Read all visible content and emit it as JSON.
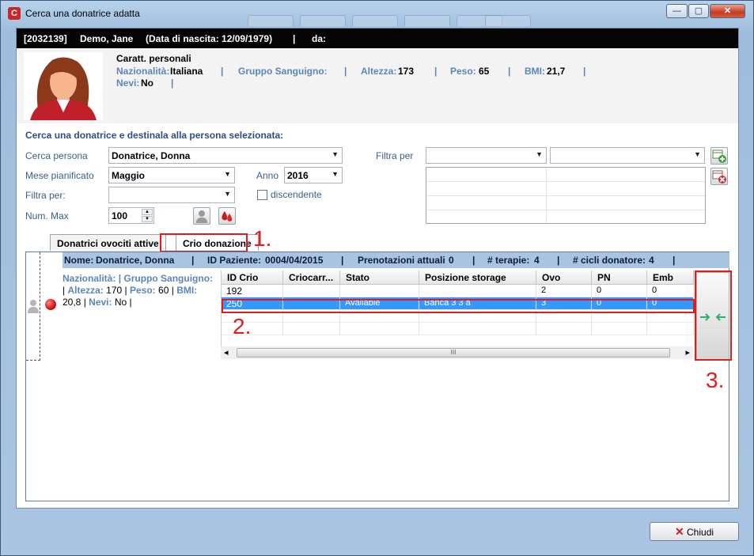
{
  "window": {
    "title": "Cerca una donatrice adatta",
    "app_icon_glyph": "C",
    "minimize_glyph": "—",
    "maximize_glyph": "▢",
    "close_glyph": "✕"
  },
  "patient_bar": {
    "id": "[2032139]",
    "name": "Demo, Jane",
    "birth": "(Data di nascita: 12/09/1979)",
    "sep": "|",
    "da": "da:"
  },
  "personal": {
    "title": "Caratt. personali",
    "nazionalita_label": "Nazionalità:",
    "nazionalita_value": "Italiana",
    "gruppo_label": "Gruppo Sanguigno:",
    "altezza_label": "Altezza:",
    "altezza_value": "173",
    "peso_label": "Peso:",
    "peso_value": "65",
    "bmi_label": "BMI:",
    "bmi_value": "21,7",
    "nevi_label": "Nevi:",
    "nevi_value": "No",
    "sep": "|"
  },
  "search": {
    "section_title": "Cerca una donatrice e destinala alla persona selezionata:",
    "cerca_persona_label": "Cerca persona",
    "cerca_persona_value": "Donatrice, Donna",
    "mese_label": "Mese pianificato",
    "mese_value": "Maggio",
    "anno_label": "Anno",
    "anno_value": "2016",
    "filtra_label": "Filtra per:",
    "filtra_value": "",
    "num_max_label": "Num. Max",
    "num_max_value": "100",
    "discendente_label": "discendente",
    "filtra_per_right_label": "Filtra per",
    "dropdown_arrow": "▼"
  },
  "tabs": {
    "tab1": "Donatrici ovociti attive",
    "tab2": "Crio donazione"
  },
  "annotations": {
    "n1": "1.",
    "n2": "2.",
    "n3": "3."
  },
  "donor_bar": {
    "nome_label": "Nome:",
    "nome_value": "Donatrice, Donna",
    "id_label": "ID Paziente:",
    "id_value": "0004/04/2015",
    "pren_label": "Prenotazioni attuali",
    "pren_value": "0",
    "terapie_label": "# terapie:",
    "terapie_value": "4",
    "cicli_label": "# cicli donatore:",
    "cicli_value": "4",
    "sep": "|"
  },
  "donor_info": {
    "nazionalita_label": "Nazionalità:",
    "gruppo_label": "Gruppo Sanguigno:",
    "altezza_label": "Altezza:",
    "altezza_value": "170",
    "peso_label": "Peso:",
    "peso_value": "60",
    "bmi_label": "BMI:",
    "bmi_value": "20,8",
    "nevi_label": "Nevi:",
    "nevi_value": "No",
    "sep": "|"
  },
  "table": {
    "columns": [
      "ID Crio",
      "Criocarr...",
      "Stato",
      "Posizione storage",
      "Ovo",
      "PN",
      "Emb"
    ],
    "rows": [
      [
        "192",
        "",
        "",
        "",
        "2",
        "0",
        "0"
      ],
      [
        "250",
        "",
        "Available",
        "Banca 3 3 a",
        "3",
        "0",
        "0"
      ]
    ],
    "selected_row": 1
  },
  "scrollbar": {
    "left_glyph": "◂",
    "right_glyph": "▸",
    "grip_glyph": "III"
  },
  "transfer_icon": "→←",
  "footer": {
    "close_label": "Chiudi",
    "close_glyph": "✕"
  },
  "colors": {
    "accent_red": "#e21b1b",
    "selection_blue": "#3399ff",
    "label_blue": "#5b86b8"
  }
}
